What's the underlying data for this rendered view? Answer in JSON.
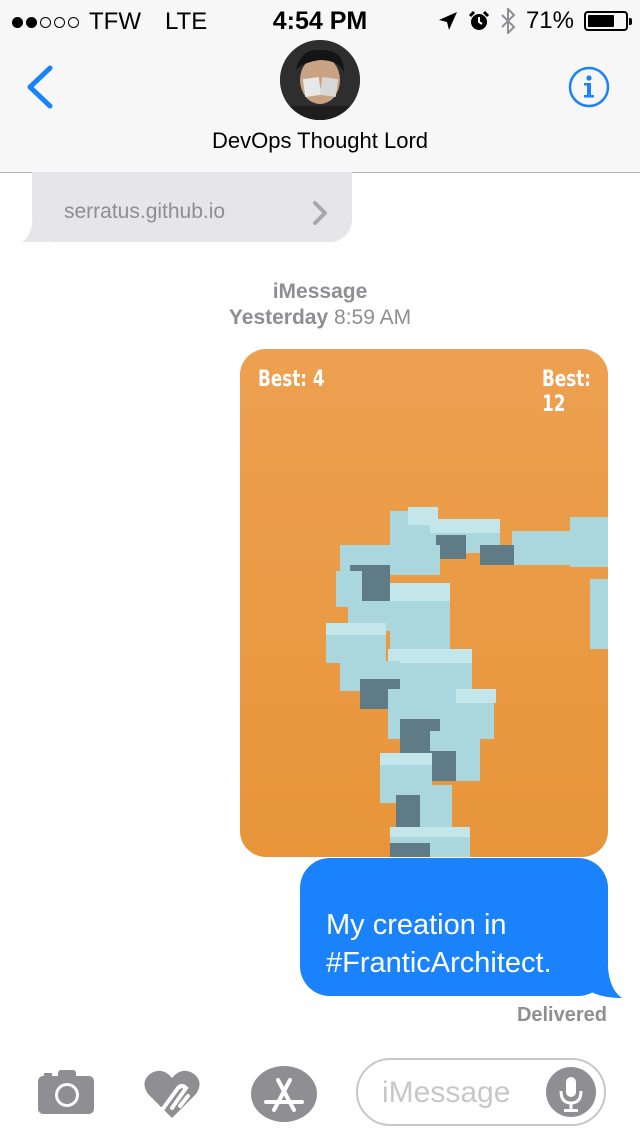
{
  "status_bar": {
    "signal_dots": [
      true,
      true,
      false,
      false,
      false
    ],
    "carrier": "TFW",
    "network": "LTE",
    "time": "4:54 PM",
    "battery": "71%",
    "battery_level": 0.71,
    "icons": [
      "location-arrow-icon",
      "alarm-icon",
      "bluetooth-icon",
      "battery-icon"
    ]
  },
  "header": {
    "contact_name": "DevOps Thought Lord",
    "back_icon": "chevron-left-icon",
    "info_icon": "info-icon"
  },
  "conversation": {
    "link_preview": {
      "domain": "serratus.github.io",
      "chevron_icon": "chevron-right-icon"
    },
    "timestamp": {
      "service": "iMessage",
      "day": "Yesterday",
      "time": "8:59 AM"
    },
    "image_message": {
      "best_left": "Best: 4",
      "best_right": "Best: 12"
    },
    "text_message": {
      "line1": "My creation in",
      "line2": "#FranticArchitect."
    },
    "status": "Delivered"
  },
  "compose": {
    "camera_icon": "camera-icon",
    "digital_touch_icon": "heart-hand-icon",
    "app_store_icon": "app-store-icon",
    "placeholder": "iMessage",
    "mic_icon": "microphone-icon"
  },
  "colors": {
    "accent": "#1a82fb",
    "received_bubble": "#e5e5ea",
    "image_bg": "#e8953a",
    "blocks": "#a9d7dd"
  }
}
